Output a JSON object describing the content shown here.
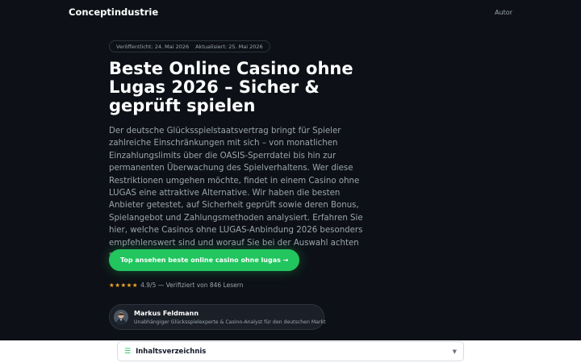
{
  "header": {
    "brand": "Conceptindustrie",
    "nav_author": "Autor"
  },
  "meta": {
    "published": "Veröffentlicht: 24. Mai 2026",
    "updated": "Aktualisiert: 25. Mai 2026"
  },
  "article": {
    "title": "Beste Online Casino ohne Lugas 2026 – Sicher & geprüft spielen",
    "intro": "Der deutsche Glücksspielstaatsvertrag bringt für Spieler zahlreiche Einschränkungen mit sich – von monatlichen Einzahlungslimits über die OASIS-Sperrdatei bis hin zur permanenten Überwachung des Spielverhaltens. Wer diese Restriktionen umgehen möchte, findet in einem Casino ohne LUGAS eine attraktive Alternative. Wir haben die besten Anbieter getestet, auf Sicherheit geprüft sowie deren Bonus, Spielangebot und Zahlungsmethoden analysiert. Erfahren Sie hier, welche Casinos ohne LUGAS-Anbindung 2026 besonders empfehlenswert sind und worauf Sie bei der Auswahl achten sollten.",
    "cta_label": "Top ansehen beste online casino ohne lugas →"
  },
  "rating": {
    "stars": "★★★★★",
    "text": "4.9/5 — Verifiziert von 846 Lesern"
  },
  "author": {
    "name": "Markus Feldmann",
    "bio": "Unabhängiger Glücksspielexperte & Casino-Analyst für den deutschen Markt"
  },
  "toc": {
    "icon": "☰",
    "label": "Inhaltsverzeichnis",
    "chevron": "▼"
  },
  "colors": {
    "background": "#0d1117",
    "accent": "#22c55e",
    "star": "#f5a524"
  }
}
